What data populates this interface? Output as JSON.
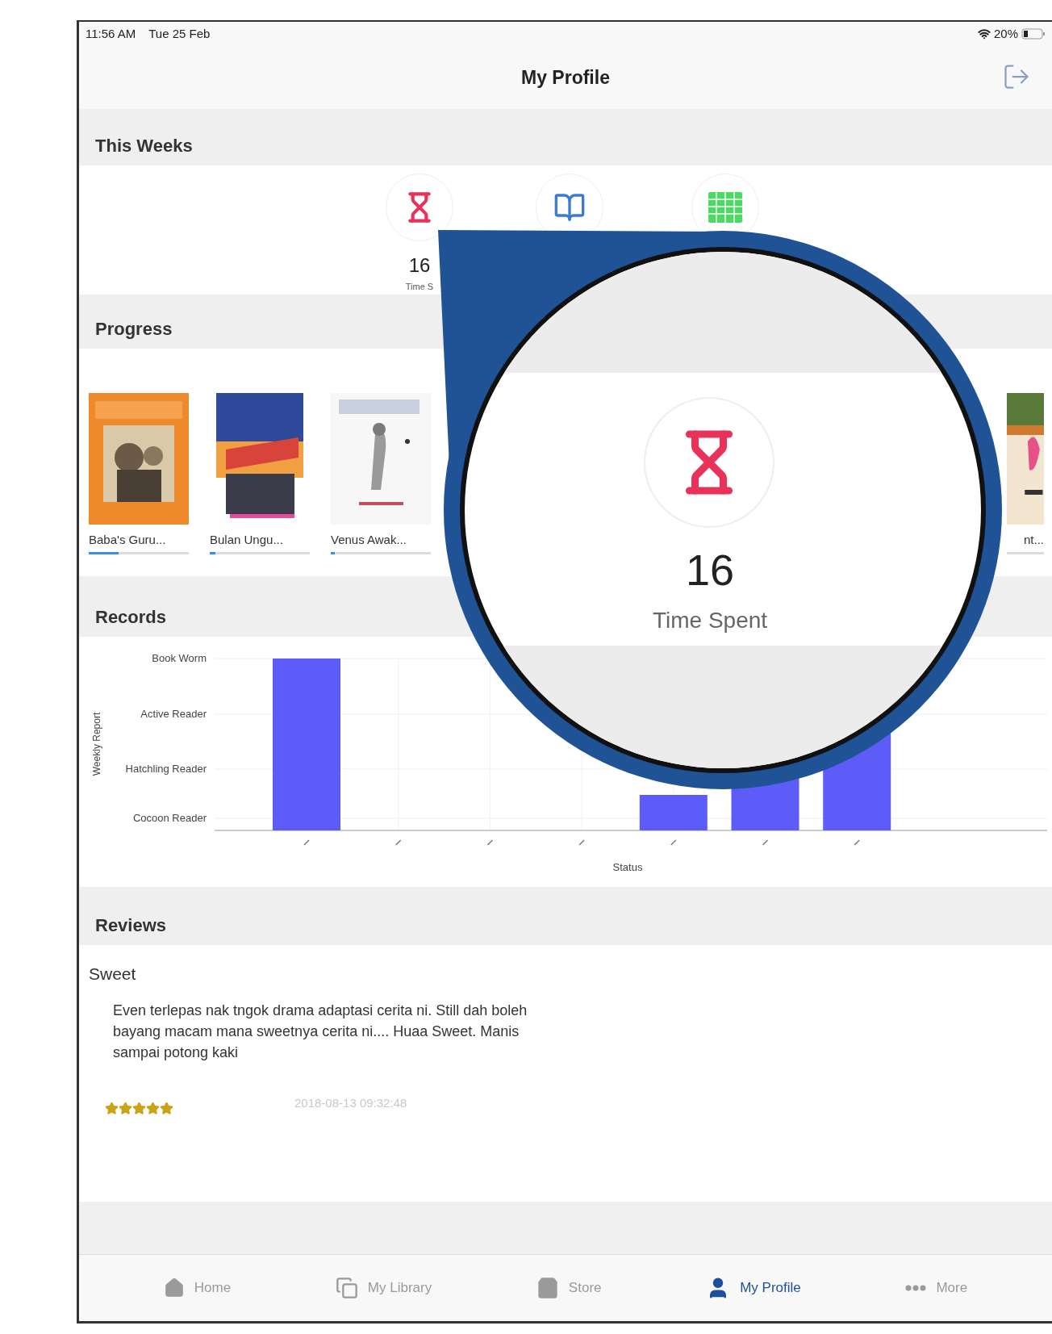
{
  "status_bar": {
    "time": "11:56 AM",
    "date": "Tue 25 Feb",
    "battery": "20%"
  },
  "nav": {
    "title": "My Profile"
  },
  "this_weeks": {
    "title": "This Weeks",
    "stats": [
      {
        "kind": "time",
        "value": "16",
        "label": "Time S"
      },
      {
        "kind": "reading"
      },
      {
        "kind": "calendar"
      }
    ]
  },
  "progress": {
    "title": "Progress",
    "books": [
      {
        "title": "Baba's Guru...",
        "level": 0.3
      },
      {
        "title": "Bulan Ungu...",
        "level": 0.06
      },
      {
        "title": "Venus Awak...",
        "level": 0.04
      },
      {
        "title": "nt...",
        "level": 0
      }
    ]
  },
  "records": {
    "title": "Records",
    "chart": {
      "x_axis_title": "Status",
      "y_axis_title": "Weekly Report",
      "y_axis_labels": [
        "Book Worm",
        "Active Reader",
        "Hatchling Reader",
        "Cocoon Reader"
      ]
    }
  },
  "reviews": {
    "title": "Reviews",
    "items": [
      {
        "title": "Sweet",
        "body": "Even terlepas nak tngok drama adaptasi cerita ni. Still dah boleh bayang macam mana sweetnya cerita ni.... Huaa Sweet. Manis sampai potong kaki",
        "stars": 5,
        "date": "2018-08-13 09:32:48"
      }
    ]
  },
  "tab_bar": [
    {
      "kind": "home",
      "label": "Home",
      "selected": false
    },
    {
      "kind": "library",
      "label": "My Library",
      "selected": false
    },
    {
      "kind": "store",
      "label": "Store",
      "selected": false
    },
    {
      "kind": "profile",
      "label": "My Profile",
      "selected": true
    },
    {
      "kind": "more",
      "label": "More",
      "selected": false
    }
  ],
  "magnifier": {
    "value": "16",
    "label": "Time Spent"
  }
}
